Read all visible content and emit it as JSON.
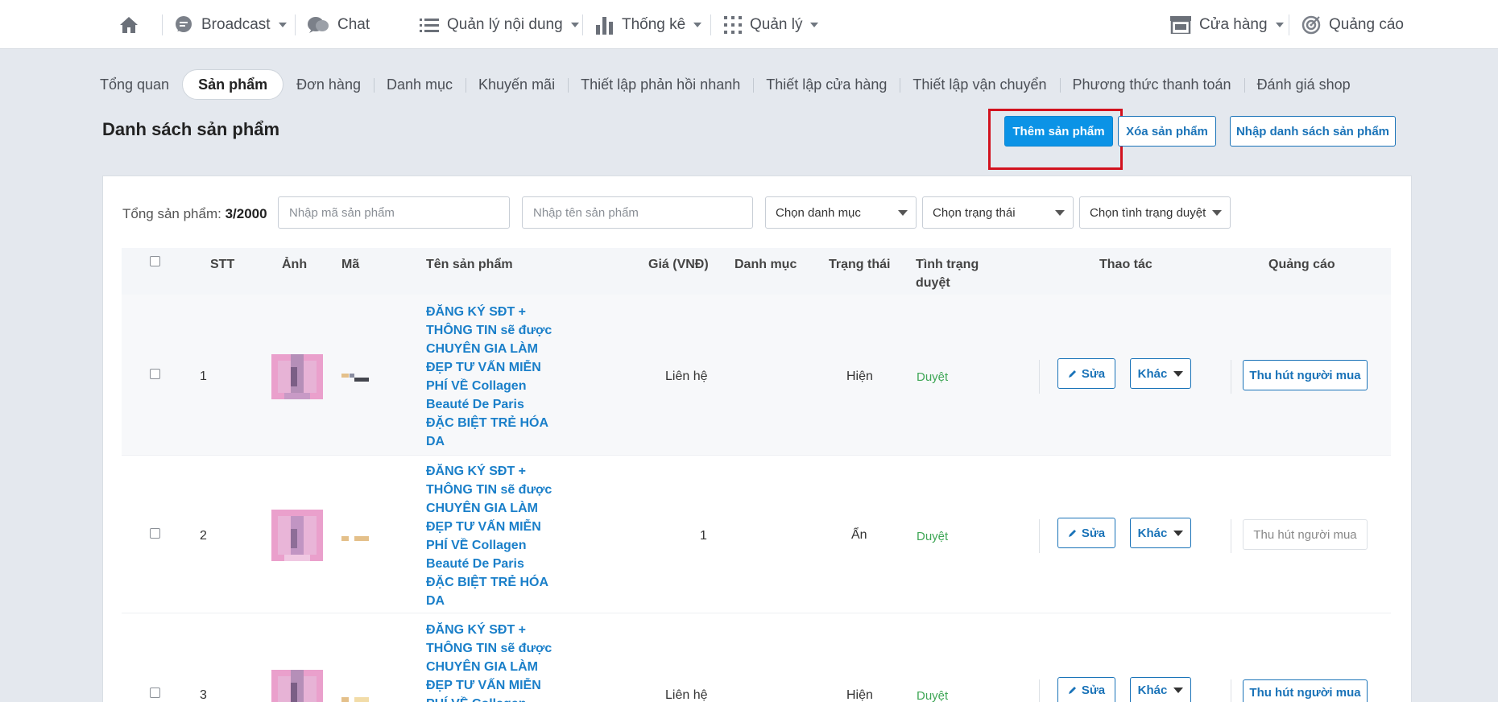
{
  "nav": {
    "home": "home-icon",
    "broadcast": "Broadcast",
    "chat": "Chat",
    "content": "Quản lý nội dung",
    "stats": "Thống kê",
    "manage": "Quản lý",
    "store": "Cửa hàng",
    "ads": "Quảng cáo"
  },
  "tabs": [
    "Tổng quan",
    "Sản phẩm",
    "Đơn hàng",
    "Danh mục",
    "Khuyến mãi",
    "Thiết lập phản hồi nhanh",
    "Thiết lập cửa hàng",
    "Thiết lập vận chuyển",
    "Phương thức thanh toán",
    "Đánh giá shop"
  ],
  "page": {
    "title": "Danh sách sản phẩm",
    "add": "Thêm sản phẩm",
    "delete": "Xóa sản phẩm",
    "import": "Nhập danh sách sản phẩm"
  },
  "filters": {
    "total_label": "Tổng sản phẩm:",
    "total_value": "3/2000",
    "code_placeholder": "Nhập mã sản phẩm",
    "name_placeholder": "Nhập tên sản phẩm",
    "category": "Chọn danh mục",
    "status": "Chọn trạng thái",
    "review": "Chọn tình trạng duyệt"
  },
  "table": {
    "headers": {
      "stt": "STT",
      "image": "Ảnh",
      "code": "Mã",
      "name": "Tên sản phẩm",
      "price": "Giá (VNĐ)",
      "category": "Danh mục",
      "status": "Trạng thái",
      "review_l1": "Tình trạng",
      "review_l2": "duyệt",
      "actions": "Thao tác",
      "ads": "Quảng cáo"
    },
    "rows": [
      {
        "stt": "1",
        "name": [
          "ĐĂNG KÝ SĐT +",
          "THÔNG TIN sẽ được",
          "CHUYÊN GIA LÀM",
          "ĐẸP TƯ VẤN MIỄN",
          "PHÍ VỀ Collagen",
          "Beauté De Paris",
          "ĐẶC BIỆT TRẺ HÓA",
          "DA"
        ],
        "price": "Liên hệ",
        "status": "Hiện",
        "review": "Duyệt",
        "edit": "Sửa",
        "more": "Khác",
        "ad": "Thu hút người mua"
      },
      {
        "stt": "2",
        "name": [
          "ĐĂNG KÝ SĐT +",
          "THÔNG TIN sẽ được",
          "CHUYÊN GIA LÀM",
          "ĐẸP TƯ VẤN MIỄN",
          "PHÍ VỀ Collagen",
          "Beauté De Paris",
          "ĐẶC BIỆT TRẺ HÓA",
          "DA"
        ],
        "price": "1",
        "status": "Ẩn",
        "review": "Duyệt",
        "edit": "Sửa",
        "more": "Khác",
        "ad": "Thu hút người mua"
      },
      {
        "stt": "3",
        "name": [
          "ĐĂNG KÝ SĐT +",
          "THÔNG TIN sẽ được",
          "CHUYÊN GIA LÀM",
          "ĐẸP TƯ VẤN MIỄN",
          "PHÍ VỀ Collagen"
        ],
        "price": "Liên hệ",
        "status": "Hiện",
        "review": "Duyệt",
        "edit": "Sửa",
        "more": "Khác",
        "ad": "Thu hút người mua"
      }
    ]
  },
  "colors": {
    "primary": "#0b93e6",
    "link": "#1a7fc9",
    "approved": "#3ea655",
    "highlight": "#d2121e"
  }
}
